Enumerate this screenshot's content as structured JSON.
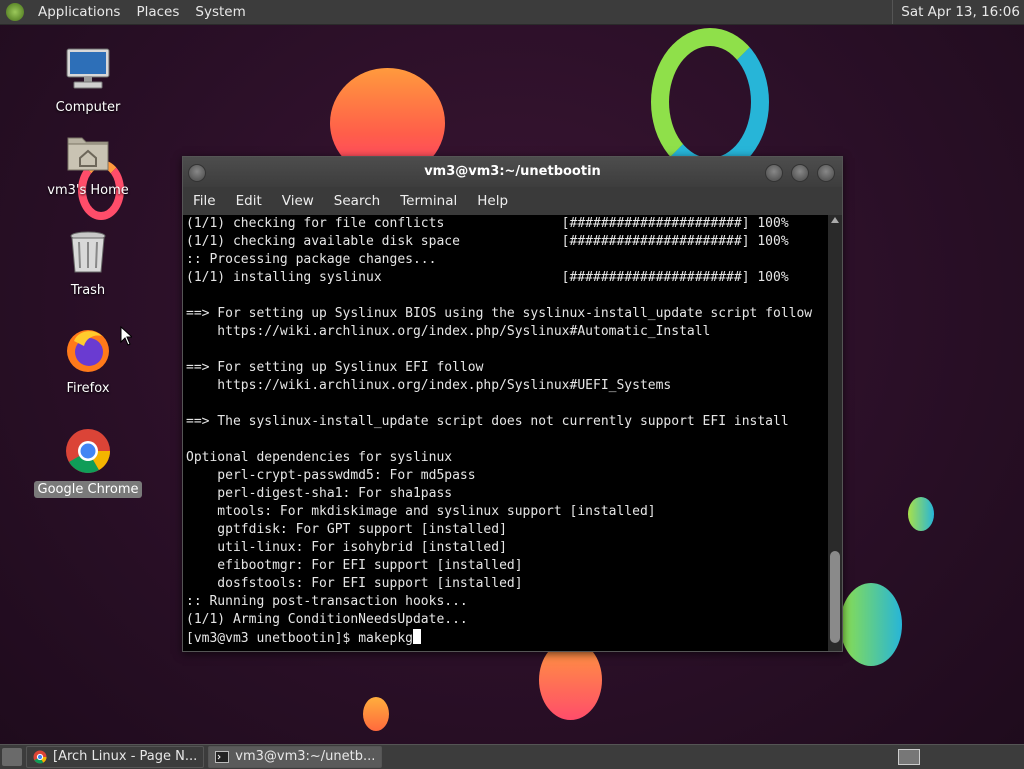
{
  "top_panel": {
    "menus": [
      "Applications",
      "Places",
      "System"
    ],
    "clock": "Sat Apr 13, 16:06"
  },
  "desktop": {
    "icons": [
      {
        "label": "Computer",
        "icon": "computer-icon"
      },
      {
        "label": "vm3's Home",
        "icon": "home-folder-icon"
      },
      {
        "label": "Trash",
        "icon": "trash-icon"
      },
      {
        "label": "Firefox",
        "icon": "firefox-icon"
      },
      {
        "label": "Google Chrome",
        "icon": "chrome-icon",
        "selected": true
      }
    ]
  },
  "terminal": {
    "title": "vm3@vm3:~/unetbootin",
    "menus": [
      "File",
      "Edit",
      "View",
      "Search",
      "Terminal",
      "Help"
    ],
    "lines": [
      "(1/1) checking for file conflicts               [######################] 100%",
      "(1/1) checking available disk space             [######################] 100%",
      ":: Processing package changes...",
      "(1/1) installing syslinux                       [######################] 100%",
      "",
      "==> For setting up Syslinux BIOS using the syslinux-install_update script follow",
      "    https://wiki.archlinux.org/index.php/Syslinux#Automatic_Install",
      "",
      "==> For setting up Syslinux EFI follow",
      "    https://wiki.archlinux.org/index.php/Syslinux#UEFI_Systems",
      "",
      "==> The syslinux-install_update script does not currently support EFI install",
      "",
      "Optional dependencies for syslinux",
      "    perl-crypt-passwdmd5: For md5pass",
      "    perl-digest-sha1: For sha1pass",
      "    mtools: For mkdiskimage and syslinux support [installed]",
      "    gptfdisk: For GPT support [installed]",
      "    util-linux: For isohybrid [installed]",
      "    efibootmgr: For EFI support [installed]",
      "    dosfstools: For EFI support [installed]",
      ":: Running post-transaction hooks...",
      "(1/1) Arming ConditionNeedsUpdate..."
    ],
    "prompt": "[vm3@vm3 unetbootin]$ ",
    "command": "makepkg"
  },
  "taskbar": {
    "tasks": [
      {
        "label": "[Arch Linux - Page N...",
        "icon": "chrome-icon",
        "active": false
      },
      {
        "label": "vm3@vm3:~/unetb...",
        "icon": "terminal-icon",
        "active": true
      }
    ]
  },
  "colors": {
    "desktop_bg": "#2a1226",
    "panel": "#3c3c3c",
    "terminal_bg": "#000000",
    "terminal_fg": "#e6e6e6"
  }
}
